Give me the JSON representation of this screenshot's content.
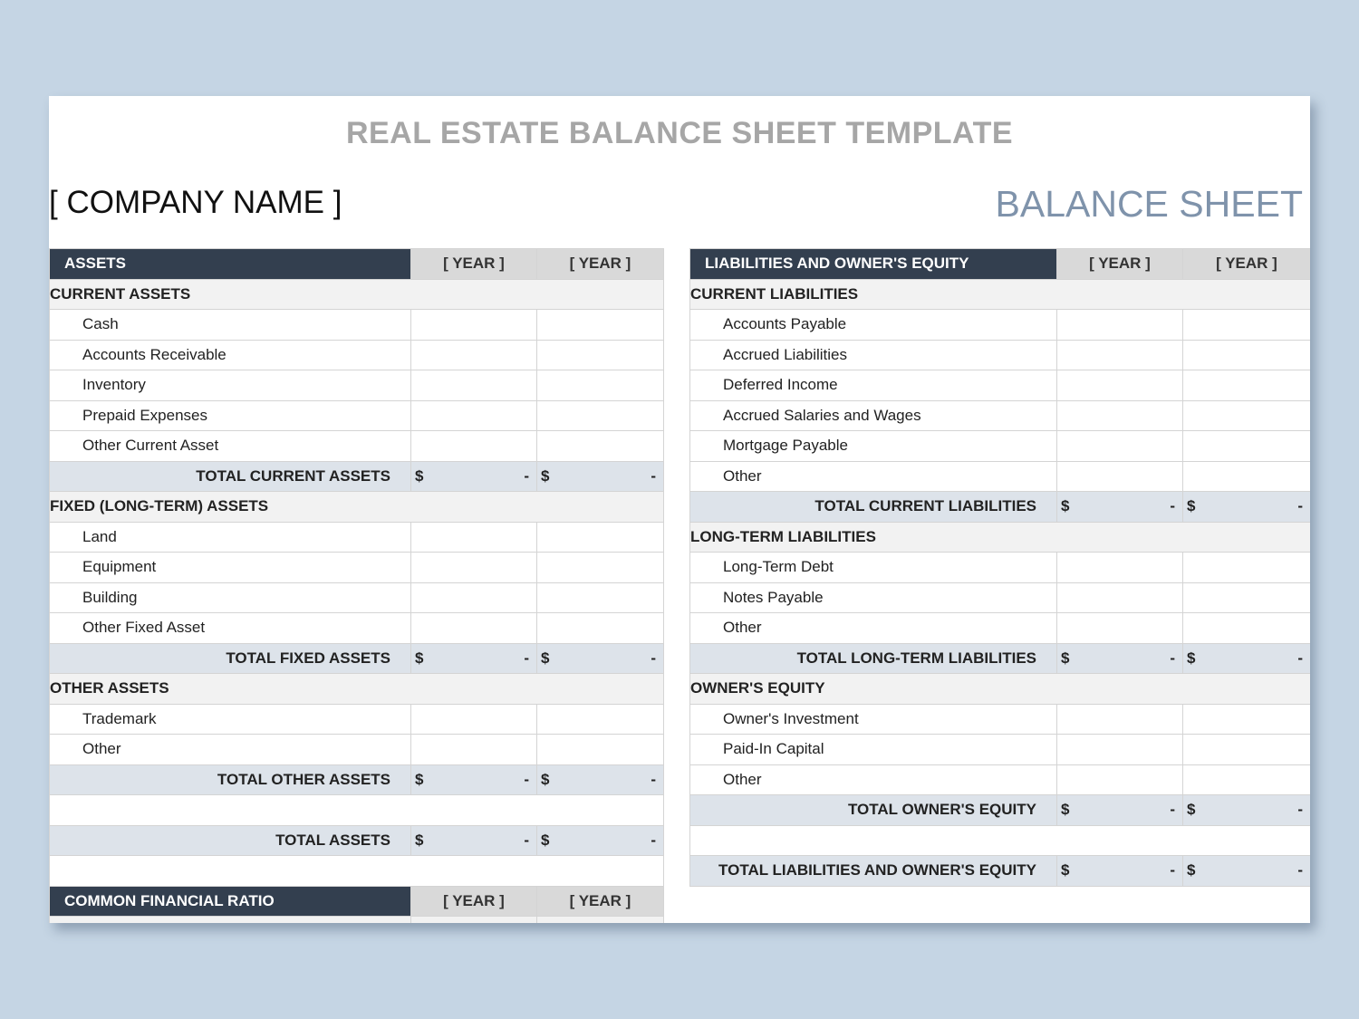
{
  "title": "REAL ESTATE BALANCE SHEET TEMPLATE",
  "company_name": "[ COMPANY NAME ]",
  "sheet_label": "BALANCE SHEET",
  "assets": {
    "header": "ASSETS",
    "year1": "[ YEAR ]",
    "year2": "[ YEAR ]",
    "current": {
      "title": "CURRENT ASSETS",
      "items": [
        "Cash",
        "Accounts Receivable",
        "Inventory",
        "Prepaid Expenses",
        "Other Current Asset"
      ],
      "total": "TOTAL CURRENT ASSETS"
    },
    "fixed": {
      "title": "FIXED (LONG-TERM) ASSETS",
      "items": [
        "Land",
        "Equipment",
        "Building",
        "Other Fixed Asset"
      ],
      "total": "TOTAL FIXED ASSETS"
    },
    "other": {
      "title": "OTHER ASSETS",
      "items": [
        "Trademark",
        "Other"
      ],
      "total": "TOTAL OTHER ASSETS"
    },
    "grand_total": "TOTAL ASSETS"
  },
  "ratio": {
    "header": "COMMON FINANCIAL RATIO",
    "year1": "[ YEAR ]",
    "year2": "[ YEAR ]"
  },
  "liabilities": {
    "header": "LIABILITIES AND OWNER'S EQUITY",
    "year1": "[ YEAR ]",
    "year2": "[ YEAR ]",
    "current": {
      "title": "CURRENT LIABILITIES",
      "items": [
        "Accounts Payable",
        "Accrued Liabilities",
        "Deferred Income",
        "Accrued Salaries and Wages",
        "Mortgage Payable",
        "Other"
      ],
      "total": "TOTAL CURRENT LIABILITIES"
    },
    "longterm": {
      "title": "LONG-TERM LIABILITIES",
      "items": [
        "Long-Term Debt",
        "Notes Payable",
        "Other"
      ],
      "total": "TOTAL LONG-TERM LIABILITIES"
    },
    "equity": {
      "title": "OWNER'S EQUITY",
      "items": [
        "Owner's Investment",
        "Paid-In Capital",
        "Other"
      ],
      "total": "TOTAL OWNER'S EQUITY"
    },
    "grand_total": "TOTAL LIABILITIES AND OWNER'S EQUITY"
  },
  "currency_symbol": "$",
  "empty_value": "-",
  "colors": {
    "header_dark": "#333f4f",
    "total_fill": "#dde3ea",
    "section_fill": "#f2f2f2",
    "page_background": "#c5d5e4"
  }
}
